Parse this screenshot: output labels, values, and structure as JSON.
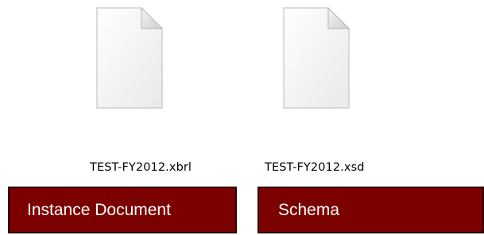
{
  "files": [
    {
      "name": "TEST-FY2012.xbrl",
      "icon": "blank-document-icon"
    },
    {
      "name": "TEST-FY2012.xsd",
      "icon": "blank-document-icon"
    }
  ],
  "captions": [
    {
      "label": "Instance Document"
    },
    {
      "label": "Schema"
    }
  ],
  "colors": {
    "caption_background": "#7b0000",
    "caption_border": "#2b0000",
    "caption_text": "#ffffff"
  }
}
